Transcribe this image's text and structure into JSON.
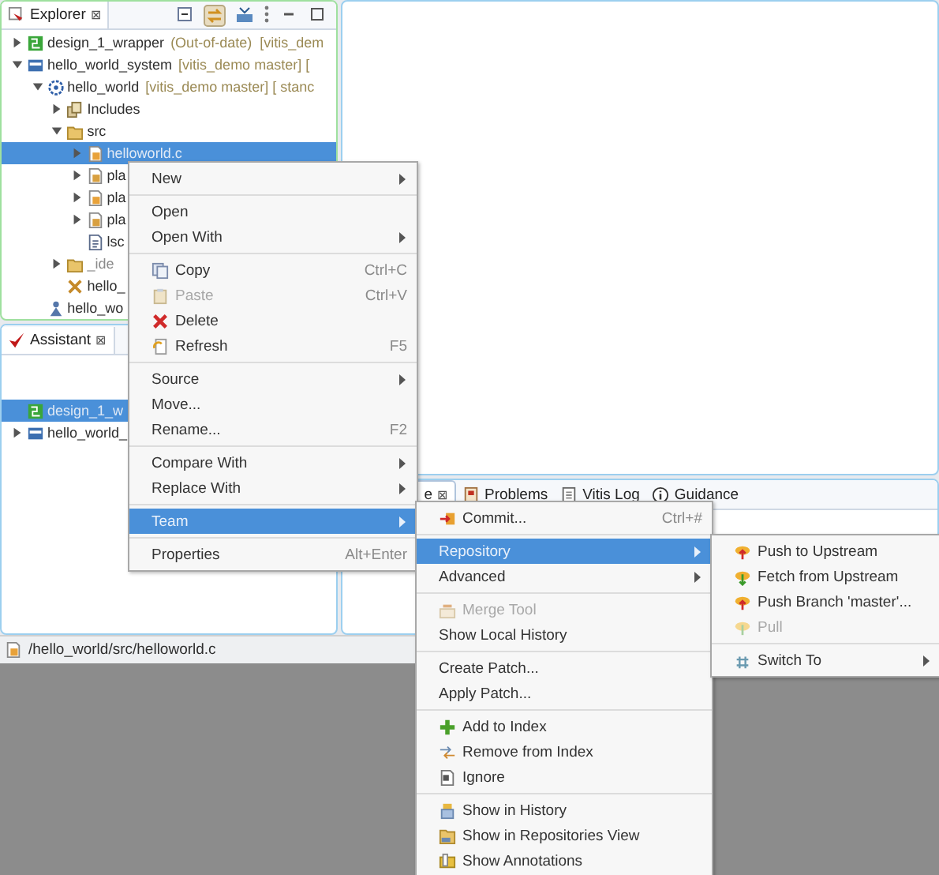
{
  "explorer": {
    "title": "Explorer",
    "close": "⊠",
    "tree": [
      {
        "label": "design_1_wrapper",
        "decoration": "(Out-of-date)  [vitis_dem",
        "kind": "hw",
        "expanded": false,
        "selected": false
      },
      {
        "label": "hello_world_system",
        "decoration": "[vitis_demo master] [",
        "kind": "system",
        "expanded": true,
        "selected": false,
        "children": [
          {
            "label": "hello_world",
            "decoration": "[vitis_demo master] [ stanc",
            "kind": "app",
            "expanded": true,
            "selected": false,
            "children": [
              {
                "label": "Includes",
                "kind": "includes",
                "expanded": false,
                "selected": false
              },
              {
                "label": "src",
                "kind": "folder",
                "expanded": true,
                "selected": false,
                "children": [
                  {
                    "label": "helloworld.c",
                    "kind": "cfile",
                    "expanded": false,
                    "selected": true
                  },
                  {
                    "label": "pla",
                    "kind": "hfile",
                    "expanded": false,
                    "selected": false
                  },
                  {
                    "label": "pla",
                    "kind": "cfile",
                    "expanded": false,
                    "selected": false
                  },
                  {
                    "label": "pla",
                    "kind": "hfile",
                    "expanded": false,
                    "selected": false
                  },
                  {
                    "label": "lsc",
                    "kind": "script",
                    "selected": false
                  }
                ]
              },
              {
                "label": "_ide",
                "kind": "folder",
                "expanded": false,
                "ignored": true,
                "selected": false
              },
              {
                "label": "hello_",
                "kind": "tools",
                "selected": false
              }
            ]
          },
          {
            "label": "hello_wo",
            "kind": "person",
            "selected": false
          }
        ]
      }
    ]
  },
  "assistant": {
    "title": "Assistant",
    "close": "⊠",
    "tree": [
      {
        "label": "design_1_w",
        "kind": "hw",
        "selected": true
      },
      {
        "label": "hello_world_",
        "kind": "system",
        "expanded": false,
        "selected": false
      }
    ]
  },
  "status_bar": {
    "path": "/hello_world/src/helloworld.c"
  },
  "console": {
    "tabs": [
      {
        "label": "e",
        "close": "⊠",
        "kind": "plain",
        "selected": true
      },
      {
        "label": "Problems",
        "kind": "problems",
        "selected": false
      },
      {
        "label": "Vitis Log",
        "kind": "log",
        "selected": false
      },
      {
        "label": "Guidance",
        "kind": "info",
        "selected": false
      }
    ]
  },
  "context_menu": {
    "items": [
      {
        "kind": "plain",
        "label": "New",
        "submenu": true,
        "selected": false,
        "disabled": false
      },
      {
        "kind": "separator"
      },
      {
        "kind": "plain",
        "label": "Open",
        "selected": false,
        "disabled": false
      },
      {
        "kind": "plain",
        "label": "Open With",
        "submenu": true,
        "selected": false,
        "disabled": false
      },
      {
        "kind": "separator"
      },
      {
        "kind": "copy",
        "label": "Copy",
        "shortcut": "Ctrl+C",
        "selected": false,
        "disabled": false
      },
      {
        "kind": "paste",
        "label": "Paste",
        "shortcut": "Ctrl+V",
        "selected": false,
        "disabled": true
      },
      {
        "kind": "delete",
        "label": "Delete",
        "selected": false,
        "disabled": false
      },
      {
        "kind": "refresh",
        "label": "Refresh",
        "shortcut": "F5",
        "selected": false,
        "disabled": false
      },
      {
        "kind": "separator"
      },
      {
        "kind": "plain",
        "label": "Source",
        "submenu": true,
        "selected": false,
        "disabled": false
      },
      {
        "kind": "plain",
        "label": "Move...",
        "selected": false,
        "disabled": false
      },
      {
        "kind": "plain",
        "label": "Rename...",
        "shortcut": "F2",
        "selected": false,
        "disabled": false
      },
      {
        "kind": "separator"
      },
      {
        "kind": "plain",
        "label": "Compare With",
        "submenu": true,
        "selected": false,
        "disabled": false
      },
      {
        "kind": "plain",
        "label": "Replace With",
        "submenu": true,
        "selected": false,
        "disabled": false
      },
      {
        "kind": "separator"
      },
      {
        "kind": "plain",
        "label": "Team",
        "submenu": true,
        "selected": true,
        "disabled": false
      },
      {
        "kind": "separator"
      },
      {
        "kind": "plain",
        "label": "Properties",
        "shortcut": "Alt+Enter",
        "selected": false,
        "disabled": false
      }
    ]
  },
  "team_menu": {
    "items": [
      {
        "kind": "commit",
        "label": "Commit...",
        "shortcut": "Ctrl+#",
        "selected": false,
        "disabled": false
      },
      {
        "kind": "separator"
      },
      {
        "kind": "plain",
        "label": "Repository",
        "submenu": true,
        "selected": true,
        "disabled": false
      },
      {
        "kind": "plain",
        "label": "Advanced",
        "submenu": true,
        "selected": false,
        "disabled": false
      },
      {
        "kind": "separator"
      },
      {
        "kind": "merge",
        "label": "Merge Tool",
        "selected": false,
        "disabled": true
      },
      {
        "kind": "plain",
        "label": "Show Local History",
        "selected": false,
        "disabled": false
      },
      {
        "kind": "separator"
      },
      {
        "kind": "plain",
        "label": "Create Patch...",
        "selected": false,
        "disabled": false
      },
      {
        "kind": "plain",
        "label": "Apply Patch...",
        "selected": false,
        "disabled": false
      },
      {
        "kind": "separator"
      },
      {
        "kind": "add",
        "label": "Add to Index",
        "selected": false,
        "disabled": false
      },
      {
        "kind": "remove",
        "label": "Remove from Index",
        "selected": false,
        "disabled": false
      },
      {
        "kind": "ignore",
        "label": "Ignore",
        "selected": false,
        "disabled": false
      },
      {
        "kind": "separator"
      },
      {
        "kind": "history",
        "label": "Show in History",
        "selected": false,
        "disabled": false
      },
      {
        "kind": "repos",
        "label": "Show in Repositories View",
        "selected": false,
        "disabled": false
      },
      {
        "kind": "annotations",
        "label": "Show Annotations",
        "selected": false,
        "disabled": false
      }
    ]
  },
  "repository_menu": {
    "items": [
      {
        "kind": "push",
        "label": "Push to Upstream",
        "selected": false,
        "disabled": false
      },
      {
        "kind": "fetch",
        "label": "Fetch from Upstream",
        "selected": false,
        "disabled": false
      },
      {
        "kind": "push",
        "label": "Push Branch 'master'...",
        "selected": false,
        "disabled": false
      },
      {
        "kind": "pull",
        "label": "Pull",
        "selected": false,
        "disabled": true
      },
      {
        "kind": "separator"
      },
      {
        "kind": "switch",
        "label": "Switch To",
        "submenu": true,
        "selected": false,
        "disabled": false
      }
    ]
  }
}
